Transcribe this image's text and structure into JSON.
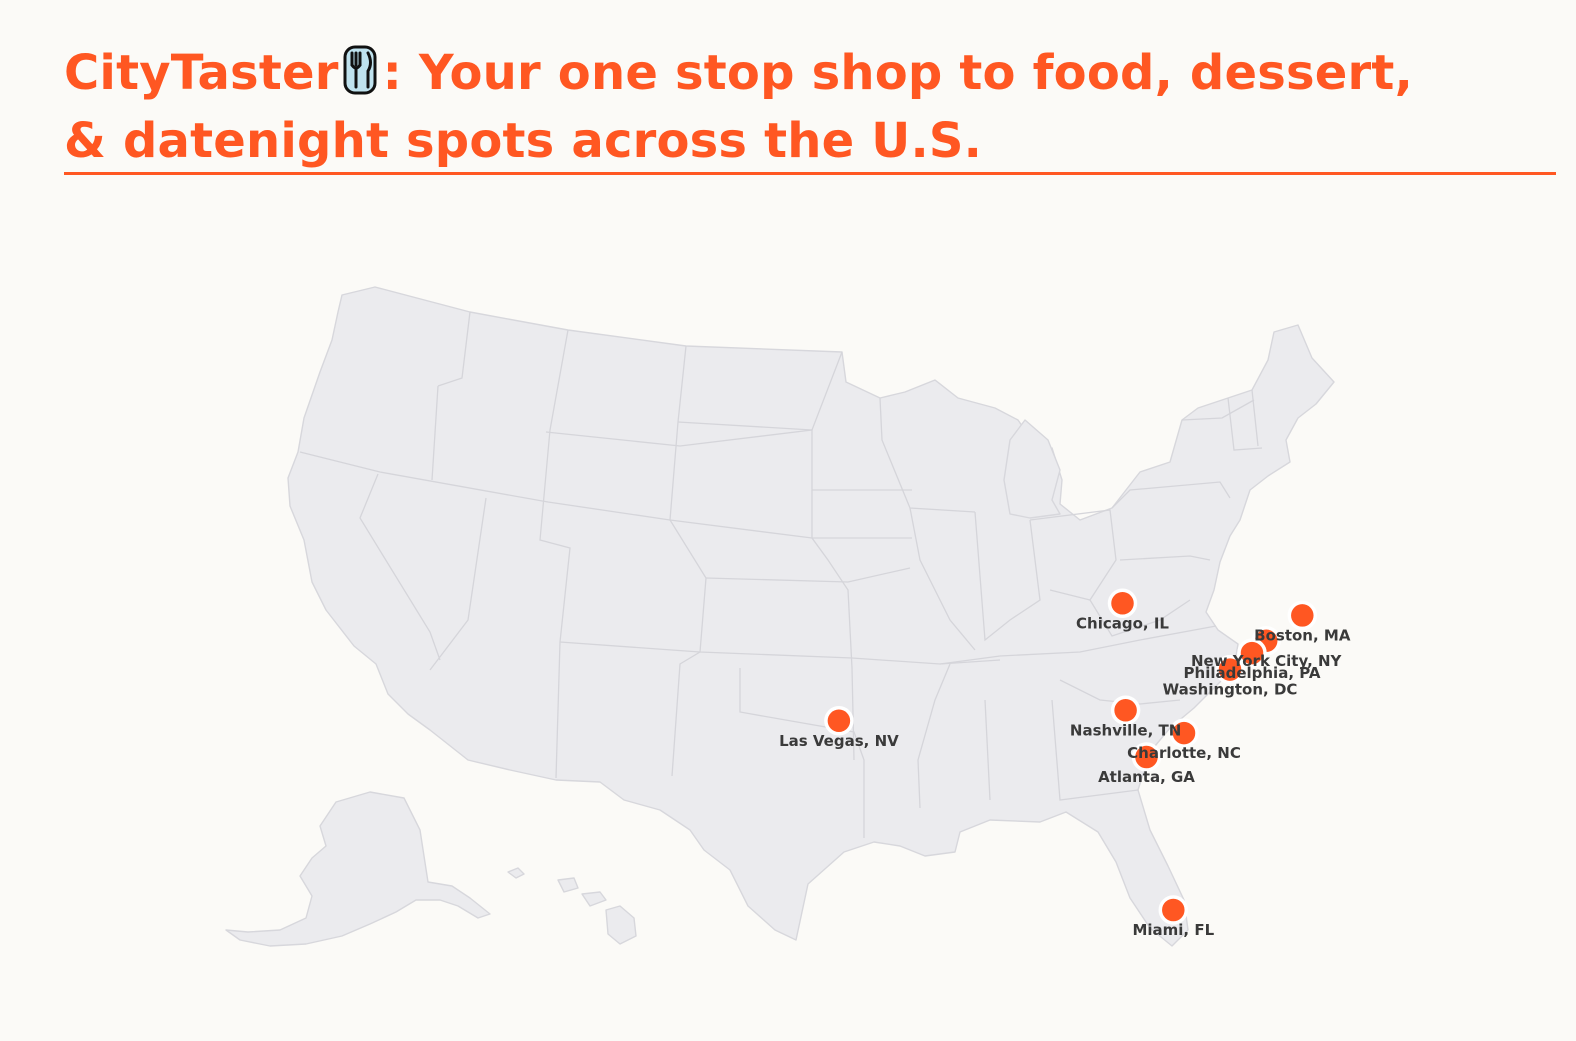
{
  "page": {
    "title": "CityTaster",
    "title_icon": "fork-knife-icon",
    "title_tagline": ": Your one stop shop to food, dessert, & datenight spots across the U.S."
  },
  "colors": {
    "accent": "#ff5722",
    "land": "#ebebee",
    "borders": "#d7d7dc",
    "background": "#fbfaf7",
    "label": "#3a3a3a"
  },
  "map": {
    "region": "United States",
    "cities": [
      {
        "name": "Boston, MA",
        "lat": 42.36,
        "lon": -71.06
      },
      {
        "name": "New York City, NY",
        "lat": 40.71,
        "lon": -74.01
      },
      {
        "name": "Philadelphia, PA",
        "lat": 39.95,
        "lon": -75.17
      },
      {
        "name": "Washington, DC",
        "lat": 38.91,
        "lon": -77.04
      },
      {
        "name": "Chicago, IL",
        "lat": 41.88,
        "lon": -87.63
      },
      {
        "name": "Las Vegas, NV",
        "lat": 36.17,
        "lon": -115.14
      },
      {
        "name": "Nashville, TN",
        "lat": 36.16,
        "lon": -86.78
      },
      {
        "name": "Charlotte, NC",
        "lat": 35.23,
        "lon": -80.84
      },
      {
        "name": "Atlanta, GA",
        "lat": 33.75,
        "lon": -84.39
      },
      {
        "name": "Miami, FL",
        "lat": 25.76,
        "lon": -80.19
      }
    ]
  }
}
